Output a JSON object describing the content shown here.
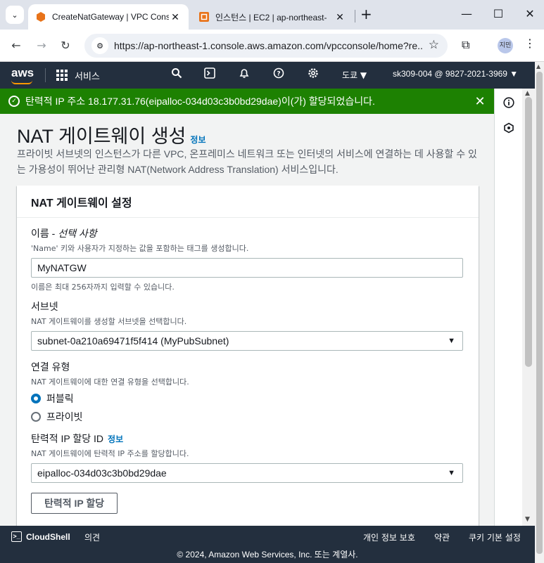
{
  "browser": {
    "tabs": [
      {
        "title": "CreateNatGateway | VPC Cons",
        "close": "✕"
      },
      {
        "title": "인스턴스 | EC2 | ap-northeast-",
        "close": "✕"
      }
    ],
    "new_tab": "+",
    "window_controls": {
      "minimize": "—",
      "maximize": "☐",
      "close": "✕"
    },
    "url": "https://ap-northeast-1.console.aws.amazon.com/vpcconsole/home?re...",
    "profile_initials": "지민"
  },
  "aws_nav": {
    "logo": "aws",
    "services_label": "서비스",
    "region": "도쿄 ▼",
    "account": "sk309-004 @ 9827-2021-3969 ▼"
  },
  "flash": {
    "message": "탄력적 IP 주소 18.177.31.76(eipalloc-034d03c3b0bd29dae)이(가) 할당되었습니다.",
    "color": "#1d8102"
  },
  "page": {
    "title": "NAT 게이트웨이 생성",
    "info_link": "정보",
    "description": "프라이빗 서브넷의 인스턴스가 다른 VPC, 온프레미스 네트워크 또는 인터넷의 서비스에 연결하는 데 사용할 수 있는 가용성이 뛰어난 관리형 NAT(Network Address Translation) 서비스입니다."
  },
  "settings": {
    "header": "NAT 게이트웨이 설정",
    "name": {
      "label": "이름 - ",
      "label_optional": "선택 사항",
      "description": "'Name' 키와 사용자가 지정하는 값을 포함하는 태그를 생성합니다.",
      "value": "MyNATGW",
      "hint": "이름은 최대 256자까지 입력할 수 있습니다."
    },
    "subnet": {
      "label": "서브넷",
      "description": "NAT 게이트웨이를 생성할 서브넷을 선택합니다.",
      "value": "subnet-0a210a69471f5f414 (MyPubSubnet)"
    },
    "connectivity": {
      "label": "연결 유형",
      "description": "NAT 게이트웨이에 대한 연결 유형을 선택합니다.",
      "options": [
        "퍼블릭",
        "프라이빗"
      ],
      "selected": "퍼블릭"
    },
    "eip": {
      "label": "탄력적 IP 할당 ID",
      "info_link": "정보",
      "description": "NAT 게이트웨이에 탄력적 IP 주소를 할당합니다.",
      "value": "eipalloc-034d03c3b0bd29dae",
      "button": "탄력적 IP 할당"
    }
  },
  "footer": {
    "cloudshell": "CloudShell",
    "feedback": "의견",
    "privacy": "개인 정보 보호",
    "terms": "약관",
    "cookies": "쿠키 기본 설정",
    "copyright": "© 2024, Amazon Web Services, Inc. 또는 계열사."
  },
  "colors": {
    "aws_nav": "#232f3e",
    "link": "#0073bb",
    "aws_orange": "#ff9900"
  }
}
